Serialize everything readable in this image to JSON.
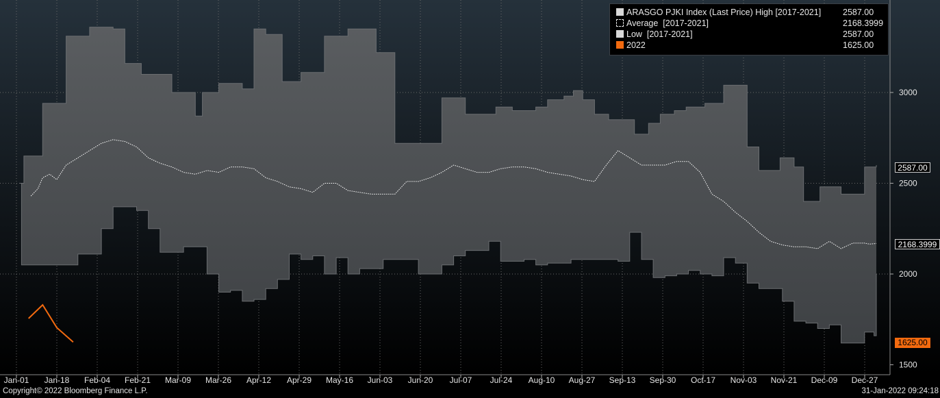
{
  "chart_data": {
    "type": "area",
    "title": "",
    "xlabel": "",
    "ylabel": "",
    "ylim": [
      1500,
      3500
    ],
    "yticks": [
      1500,
      2000,
      2500,
      3000
    ],
    "xticks": [
      "Jan-01",
      "Jan-18",
      "Feb-04",
      "Feb-21",
      "Mar-09",
      "Mar-26",
      "Apr-12",
      "Apr-29",
      "May-16",
      "Jun-03",
      "Jun-20",
      "Jul-07",
      "Jul-24",
      "Aug-10",
      "Aug-27",
      "Sep-13",
      "Sep-30",
      "Oct-17",
      "Nov-03",
      "Nov-21",
      "Dec-09",
      "Dec-27"
    ],
    "grid": true,
    "legend_position": "top-right",
    "x_domain_days": [
      0,
      365
    ],
    "series": [
      {
        "name": "ARASGO PJKI Index (Last Price) High [2017-2021]",
        "legend_value": "2587.00",
        "style": "band-upper",
        "x": [
          0,
          2,
          10,
          20,
          30,
          40,
          45,
          52,
          65,
          75,
          78,
          85,
          95,
          100,
          105,
          112,
          120,
          130,
          140,
          152,
          160,
          168,
          180,
          190,
          198,
          203,
          210,
          220,
          225,
          232,
          236,
          240,
          245,
          251,
          256,
          262,
          268,
          273,
          279,
          284,
          292,
          300,
          310,
          315,
          321,
          324,
          330,
          334,
          341,
          345,
          350,
          360,
          365
        ],
        "y": [
          2500,
          2650,
          2940,
          3310,
          3360,
          3350,
          3160,
          3100,
          3000,
          2870,
          3000,
          3050,
          3020,
          3350,
          3320,
          3060,
          3110,
          3310,
          3350,
          3220,
          2720,
          2720,
          2970,
          2880,
          2880,
          2920,
          2900,
          2920,
          2960,
          2980,
          3010,
          2960,
          2880,
          2850,
          2850,
          2770,
          2830,
          2880,
          2900,
          2920,
          2940,
          3040,
          2700,
          2570,
          2570,
          2640,
          2590,
          2400,
          2480,
          2480,
          2440,
          2590,
          2600
        ]
      },
      {
        "name": "Average [2017-2021]",
        "legend_value": "2168.3999",
        "style": "dotted",
        "x": [
          5,
          8,
          10,
          13,
          16,
          20,
          25,
          30,
          35,
          40,
          45,
          50,
          55,
          60,
          65,
          70,
          75,
          80,
          85,
          90,
          95,
          100,
          105,
          110,
          115,
          120,
          125,
          130,
          135,
          140,
          145,
          150,
          155,
          160,
          165,
          170,
          175,
          180,
          185,
          190,
          195,
          200,
          205,
          210,
          215,
          220,
          225,
          230,
          235,
          240,
          245,
          250,
          255,
          260,
          265,
          270,
          275,
          280,
          285,
          290,
          295,
          300,
          305,
          310,
          315,
          320,
          325,
          330,
          335,
          340,
          345,
          350,
          355,
          360,
          362,
          365
        ],
        "y": [
          2430,
          2470,
          2530,
          2550,
          2520,
          2600,
          2640,
          2680,
          2720,
          2740,
          2730,
          2700,
          2640,
          2610,
          2590,
          2560,
          2550,
          2570,
          2560,
          2590,
          2590,
          2580,
          2530,
          2510,
          2480,
          2470,
          2450,
          2500,
          2500,
          2460,
          2450,
          2440,
          2440,
          2440,
          2510,
          2510,
          2530,
          2560,
          2600,
          2580,
          2560,
          2560,
          2580,
          2590,
          2590,
          2580,
          2560,
          2550,
          2540,
          2520,
          2510,
          2600,
          2680,
          2640,
          2600,
          2600,
          2600,
          2620,
          2620,
          2560,
          2440,
          2400,
          2340,
          2290,
          2230,
          2180,
          2160,
          2150,
          2150,
          2140,
          2180,
          2140,
          2170,
          2170,
          2165,
          2168.4
        ]
      },
      {
        "name": "Low [2017-2021]",
        "legend_value": "2587.00",
        "style": "band-lower",
        "x": [
          0,
          1,
          10,
          20,
          25,
          30,
          35,
          40,
          45,
          50,
          55,
          60,
          65,
          70,
          75,
          80,
          85,
          90,
          95,
          100,
          105,
          110,
          115,
          120,
          125,
          130,
          135,
          140,
          145,
          150,
          155,
          160,
          165,
          170,
          175,
          180,
          185,
          190,
          195,
          200,
          205,
          210,
          215,
          220,
          225,
          230,
          235,
          240,
          245,
          250,
          255,
          260,
          265,
          270,
          275,
          280,
          285,
          290,
          295,
          300,
          305,
          310,
          315,
          320,
          325,
          330,
          335,
          340,
          345,
          350,
          355,
          360,
          364,
          365
        ],
        "y": [
          2500,
          2050,
          2050,
          2050,
          2110,
          2110,
          2250,
          2370,
          2370,
          2350,
          2250,
          2120,
          2120,
          2150,
          2150,
          2000,
          1900,
          1910,
          1850,
          1860,
          1920,
          1970,
          2110,
          2080,
          2100,
          2000,
          2090,
          2000,
          2030,
          2030,
          2080,
          2080,
          2080,
          2000,
          2000,
          2050,
          2100,
          2130,
          2130,
          2180,
          2070,
          2070,
          2080,
          2050,
          2060,
          2060,
          2080,
          2080,
          2080,
          2080,
          2070,
          2230,
          2080,
          1980,
          1990,
          2000,
          2020,
          2000,
          1990,
          2090,
          2060,
          1950,
          1920,
          1920,
          1850,
          1740,
          1730,
          1700,
          1720,
          1620,
          1620,
          1680,
          1660,
          2000
        ]
      },
      {
        "name": "2022",
        "legend_value": "1625.00",
        "style": "line",
        "x": [
          4,
          10,
          16,
          23
        ],
        "y": [
          1755,
          1830,
          1705,
          1625
        ]
      }
    ]
  },
  "legend": {
    "items": [
      {
        "label": "ARASGO PJKI Index (Last Price) High [2017-2021]",
        "value": "2587.00"
      },
      {
        "label": "Average  [2017-2021]",
        "value": "2168.3999"
      },
      {
        "label": "Low  [2017-2021]",
        "value": "2587.00"
      },
      {
        "label": "2022",
        "value": "1625.00"
      }
    ]
  },
  "tags": {
    "high": "2587.00",
    "average": "2168.3999",
    "current": "1625.00"
  },
  "footer": {
    "copyright": "Copyright© 2022 Bloomberg Finance L.P.",
    "timestamp": "31-Jan-2022 09:24:18"
  },
  "colors": {
    "band": "#4a4d50",
    "average": "#ffffff",
    "line_2022": "#f26a0f",
    "tag_orange": "#f26a0f",
    "grid": "#6a6a6a"
  }
}
